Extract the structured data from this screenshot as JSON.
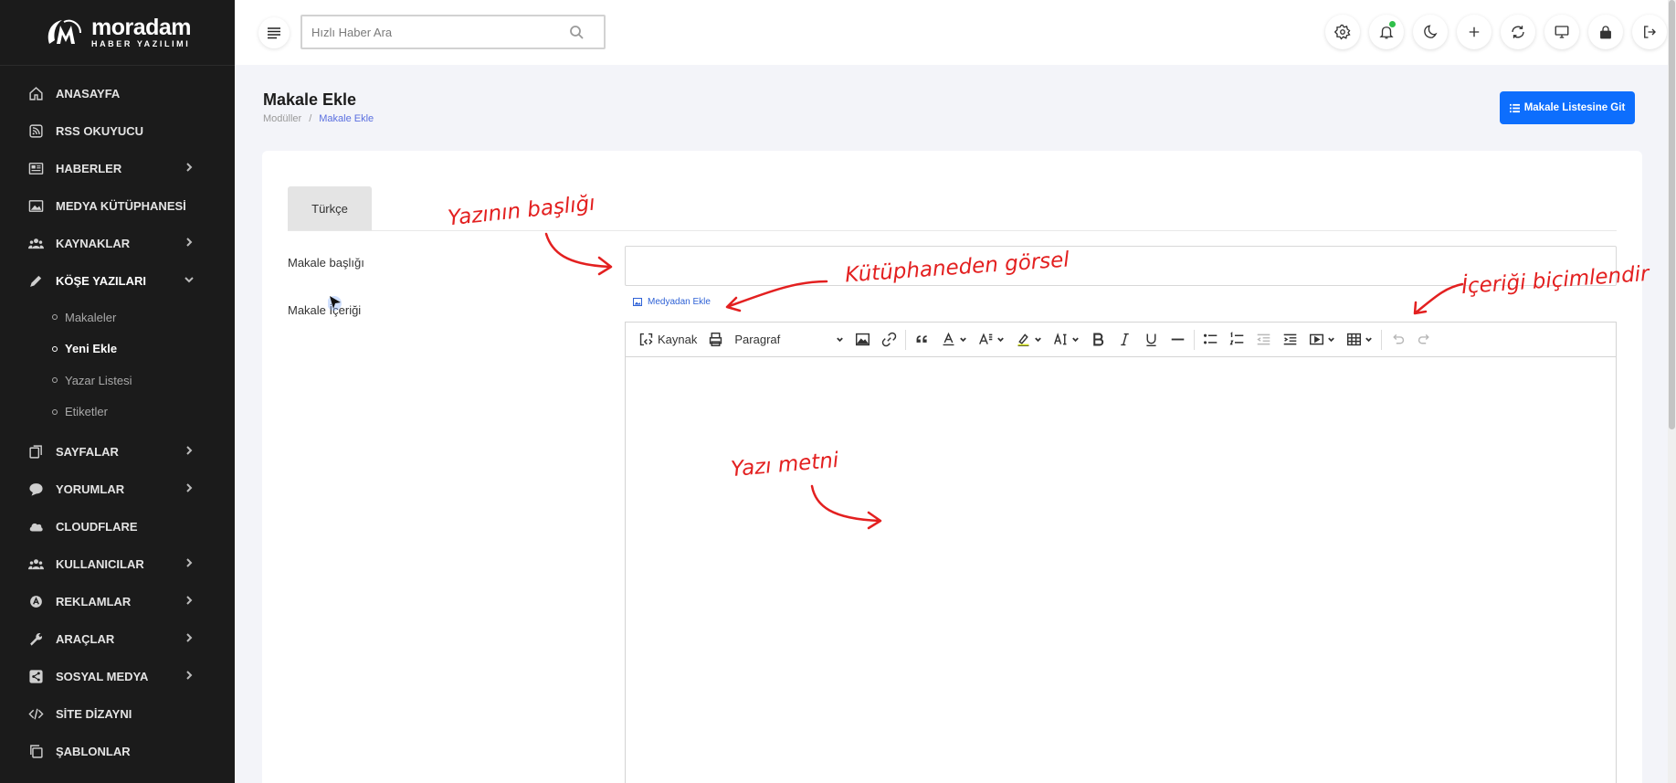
{
  "brand": {
    "name": "moradam",
    "subtitle": "HABER YAZILIMI"
  },
  "sidebar": {
    "items": [
      {
        "label": "ANASAYFA",
        "icon": "home-icon",
        "has_children": false
      },
      {
        "label": "RSS OKUYUCU",
        "icon": "rss-icon",
        "has_children": false
      },
      {
        "label": "HABERLER",
        "icon": "newspaper-icon",
        "has_children": true
      },
      {
        "label": "MEDYA KÜTÜPHANESİ",
        "icon": "image-icon",
        "has_children": false
      },
      {
        "label": "KAYNAKLAR",
        "icon": "users-icon",
        "has_children": true
      },
      {
        "label": "KÖŞE YAZILARI",
        "icon": "pen-icon",
        "has_children": true,
        "expanded": true
      },
      {
        "label": "SAYFALAR",
        "icon": "pages-icon",
        "has_children": true
      },
      {
        "label": "YORUMLAR",
        "icon": "comment-icon",
        "has_children": true
      },
      {
        "label": "CLOUDFLARE",
        "icon": "cloud-icon",
        "has_children": false
      },
      {
        "label": "KULLANICILAR",
        "icon": "users-icon",
        "has_children": true
      },
      {
        "label": "REKLAMLAR",
        "icon": "ad-icon",
        "has_children": true
      },
      {
        "label": "ARAÇLAR",
        "icon": "wrench-icon",
        "has_children": true
      },
      {
        "label": "SOSYAL MEDYA",
        "icon": "share-icon",
        "has_children": true
      },
      {
        "label": "SİTE DİZAYNI",
        "icon": "code-icon",
        "has_children": false
      },
      {
        "label": "ŞABLONLAR",
        "icon": "copy-icon",
        "has_children": false
      }
    ],
    "subitems": [
      {
        "label": "Makaleler",
        "active": false
      },
      {
        "label": "Yeni Ekle",
        "active": true
      },
      {
        "label": "Yazar Listesi",
        "active": false
      },
      {
        "label": "Etiketler",
        "active": false
      }
    ]
  },
  "topbar": {
    "search_placeholder": "Hızlı Haber Ara",
    "icons": [
      "gear-icon",
      "bell-icon",
      "moon-icon",
      "plus-icon",
      "refresh-icon",
      "monitor-icon",
      "lock-icon",
      "logout-icon"
    ],
    "notification_color": "#2fbf4a"
  },
  "page": {
    "title": "Makale Ekle",
    "breadcrumb": [
      "Modüller",
      "Makale Ekle"
    ],
    "list_button": "Makale Listesine Git"
  },
  "form": {
    "tab": "Türkçe",
    "title_label": "Makale başlığı",
    "content_label": "Makale İçeriği",
    "media_link": "Medyadan Ekle",
    "toolbar": {
      "source": "Kaynak",
      "paragraph": "Paragraf"
    }
  },
  "annotations": {
    "title": "Yazının başlığı",
    "library": "Kütüphaneden görsel",
    "format": "İçeriği biçimlendir",
    "body": "Yazı metni"
  },
  "colors": {
    "accent": "#0d6efd",
    "annotation": "#e32020",
    "sidebar_bg": "#1b1b1b"
  }
}
